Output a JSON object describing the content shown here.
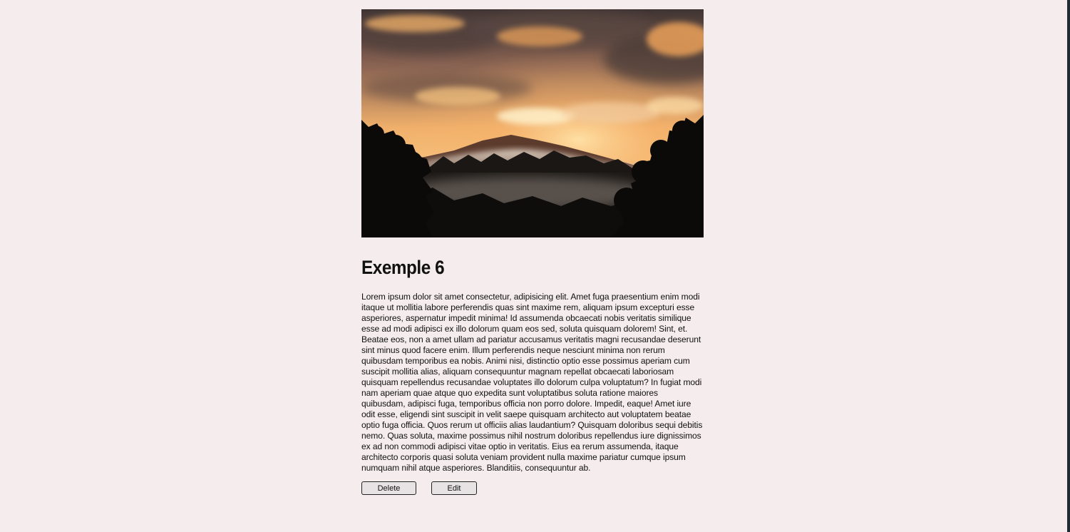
{
  "card": {
    "image": {
      "alt": "Sunset over misty forest hills"
    },
    "title": "Exemple 6",
    "description": "Lorem ipsum dolor sit amet consectetur, adipisicing elit. Amet fuga praesentium enim modi itaque ut mollitia labore perferendis quas sint maxime rem, aliquam ipsum excepturi esse asperiores, aspernatur impedit minima! Id assumenda obcaecati nobis veritatis similique esse ad modi adipisci ex illo dolorum quam eos sed, soluta quisquam dolorem! Sint, et. Beatae eos, non a amet ullam ad pariatur accusamus veritatis magni recusandae deserunt sint minus quod facere enim. Illum perferendis neque nesciunt minima non rerum quibusdam temporibus ea nobis. Animi nisi, distinctio optio esse possimus aperiam cum suscipit mollitia alias, aliquam consequuntur magnam repellat obcaecati laboriosam quisquam repellendus recusandae voluptates illo dolorum culpa voluptatum? In fugiat modi nam aperiam quae atque quo expedita sunt voluptatibus soluta ratione maiores quibusdam, adipisci fuga, temporibus officia non porro dolore. Impedit, eaque! Amet iure odit esse, eligendi sint suscipit in velit saepe quisquam architecto aut voluptatem beatae optio fuga officia. Quos rerum ut officiis alias laudantium? Quisquam doloribus sequi debitis nemo. Quas soluta, maxime possimus nihil nostrum doloribus repellendus iure dignissimos ex ad non commodi adipisci vitae optio in veritatis. Eius ea rerum assumenda, itaque architecto corporis quasi soluta veniam provident nulla maxime pariatur cumque ipsum numquam nihil atque asperiores. Blanditiis, consequuntur ab.",
    "actions": {
      "delete_label": "Delete",
      "edit_label": "Edit"
    }
  },
  "colors": {
    "page_background": "#f5eced",
    "window_edge": "#1f2a36",
    "button_background": "#e7e2e3"
  }
}
